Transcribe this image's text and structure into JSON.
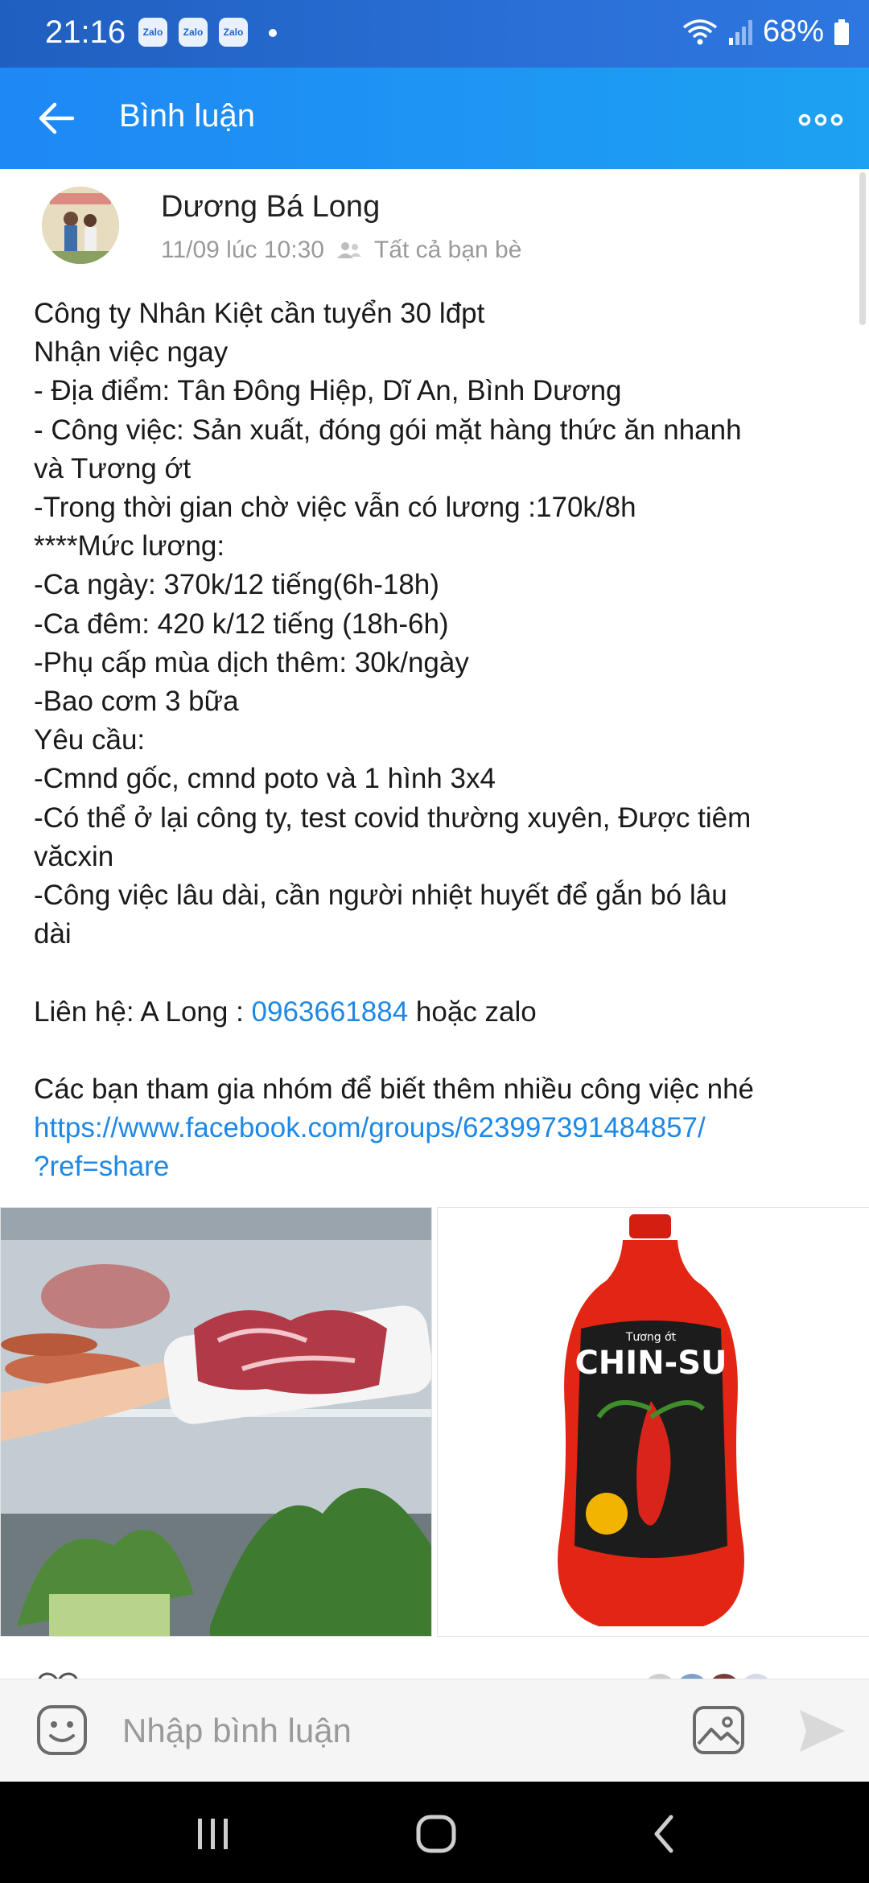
{
  "status_bar": {
    "time": "21:16",
    "notification_badges": [
      "Zalo",
      "Zalo",
      "Zalo"
    ],
    "battery": "68%"
  },
  "header": {
    "title": "Bình luận"
  },
  "post": {
    "author": "Dương Bá Long",
    "timestamp": "11/09 lúc 10:30",
    "privacy": "Tất cả bạn bè",
    "body_lines": [
      "Công ty Nhân Kiệt cần tuyển 30 lđpt",
      "Nhận việc ngay",
      "- Địa điểm: Tân Đông Hiệp, Dĩ An, Bình Dương",
      "- Công việc: Sản xuất, đóng gói mặt hàng thức ăn nhanh",
      "và Tương ớt",
      "-Trong thời gian chờ việc vẫn có lương :170k/8h",
      "****Mức lương:",
      "-Ca ngày: 370k/12 tiếng(6h-18h)",
      "-Ca đêm: 420 k/12 tiếng (18h-6h)",
      "-Phụ cấp mùa dịch thêm: 30k/ngày",
      "-Bao cơm 3 bữa",
      "Yêu cầu:",
      "-Cmnd gốc, cmnd poto và 1 hình 3x4",
      "-Có thể ở lại công ty, test covid thường xuyên, Được tiêm",
      "văcxin",
      "-Công việc lâu dài, cần người nhiệt huyết để gắn bó lâu",
      "dài"
    ],
    "contact_prefix": "Liên hệ: A Long : ",
    "contact_phone": "0963661884",
    "contact_suffix": " hoặc zalo",
    "invite_text": "Các bạn tham gia nhóm để biết thêm nhiều công việc nhé",
    "group_link_line1": "https://www.facebook.com/groups/623997391484857/",
    "group_link_line2": "?ref=share",
    "images": [
      {
        "name": "meat-tray-photo"
      },
      {
        "name": "chinsu-chili-sauce-photo",
        "label_brand": "CHIN-SU",
        "label_top": "Tương ớt"
      }
    ]
  },
  "comment_bar": {
    "placeholder": "Nhập bình luận"
  },
  "colors": {
    "status_bar": "#1f5fbf",
    "app_bar": "#1e88f5",
    "link": "#1e88e5",
    "navbar": "#000000"
  },
  "icons": [
    "back-arrow-icon",
    "more-dots-icon",
    "friends-icon",
    "emoji-icon",
    "image-icon",
    "send-icon",
    "recents-icon",
    "home-icon",
    "nav-back-icon"
  ]
}
